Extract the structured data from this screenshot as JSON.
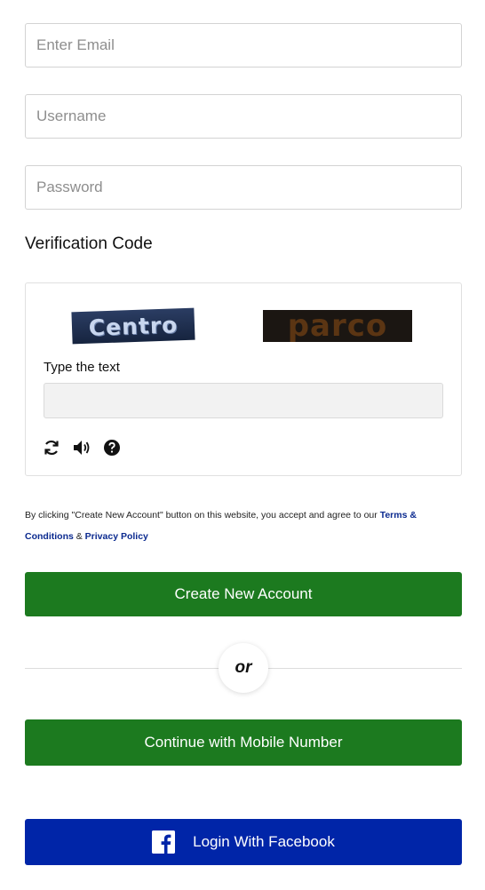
{
  "form": {
    "email_placeholder": "Enter Email",
    "username_placeholder": "Username",
    "password_placeholder": "Password"
  },
  "verification": {
    "title": "Verification Code",
    "captcha_words": [
      "Centro",
      "parco"
    ],
    "type_label": "Type the text",
    "tools": [
      "refresh-icon",
      "speaker-icon",
      "help-icon"
    ]
  },
  "terms": {
    "prefix": "By clicking \"Create New Account\" button on this website, you accept and agree to our ",
    "terms_link": "Terms & Conditions",
    "ampersand": " & ",
    "privacy_link": "Privacy Policy"
  },
  "buttons": {
    "create_label": "Create New Account",
    "or_label": "or",
    "mobile_label": "Continue with Mobile Number",
    "facebook_label": "Login With Facebook"
  },
  "colors": {
    "green": "#1c7a1f",
    "facebook_blue": "#0025a8",
    "link_blue": "#0b2a8f"
  }
}
